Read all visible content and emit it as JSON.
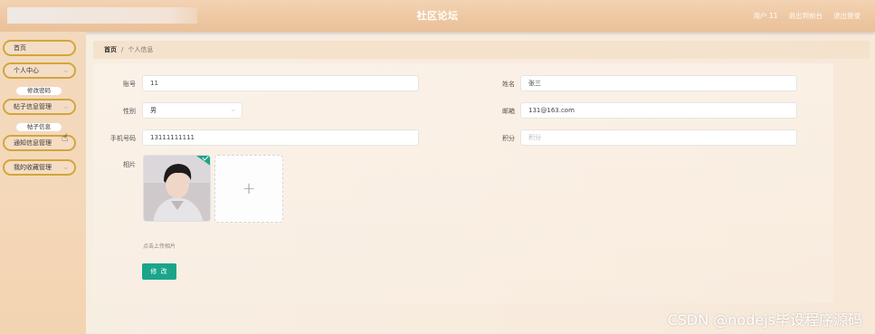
{
  "header": {
    "title": "社区论坛",
    "links": [
      "用户 11",
      "退出到前台",
      "退出登录"
    ]
  },
  "sidebar": {
    "items": [
      {
        "label": "首页"
      },
      {
        "label": "个人中心"
      },
      {
        "label": "修改密码"
      },
      {
        "label": "帖子信息管理"
      },
      {
        "label": "帖子信息"
      },
      {
        "label": "通知信息管理"
      },
      {
        "label": "我的收藏管理"
      }
    ]
  },
  "breadcrumb": {
    "home": "首页",
    "separator": "/",
    "current": "个人信息"
  },
  "form": {
    "account_label": "账号",
    "account_value": "11",
    "gender_label": "性别",
    "gender_value": "男",
    "phone_label": "手机号码",
    "phone_value": "13111111111",
    "photo_label": "相片",
    "name_label": "姓名",
    "name_value": "张三",
    "email_label": "邮箱",
    "email_value": "131@163.com",
    "points_label": "积分",
    "points_placeholder": "积分",
    "upload_tip": "点击上传相片",
    "submit_label": "修 改"
  },
  "watermark": "CSDN @nodejs毕设程序源码",
  "colors": {
    "accent": "#1aa58a",
    "menu_border": "#d2a63b"
  }
}
